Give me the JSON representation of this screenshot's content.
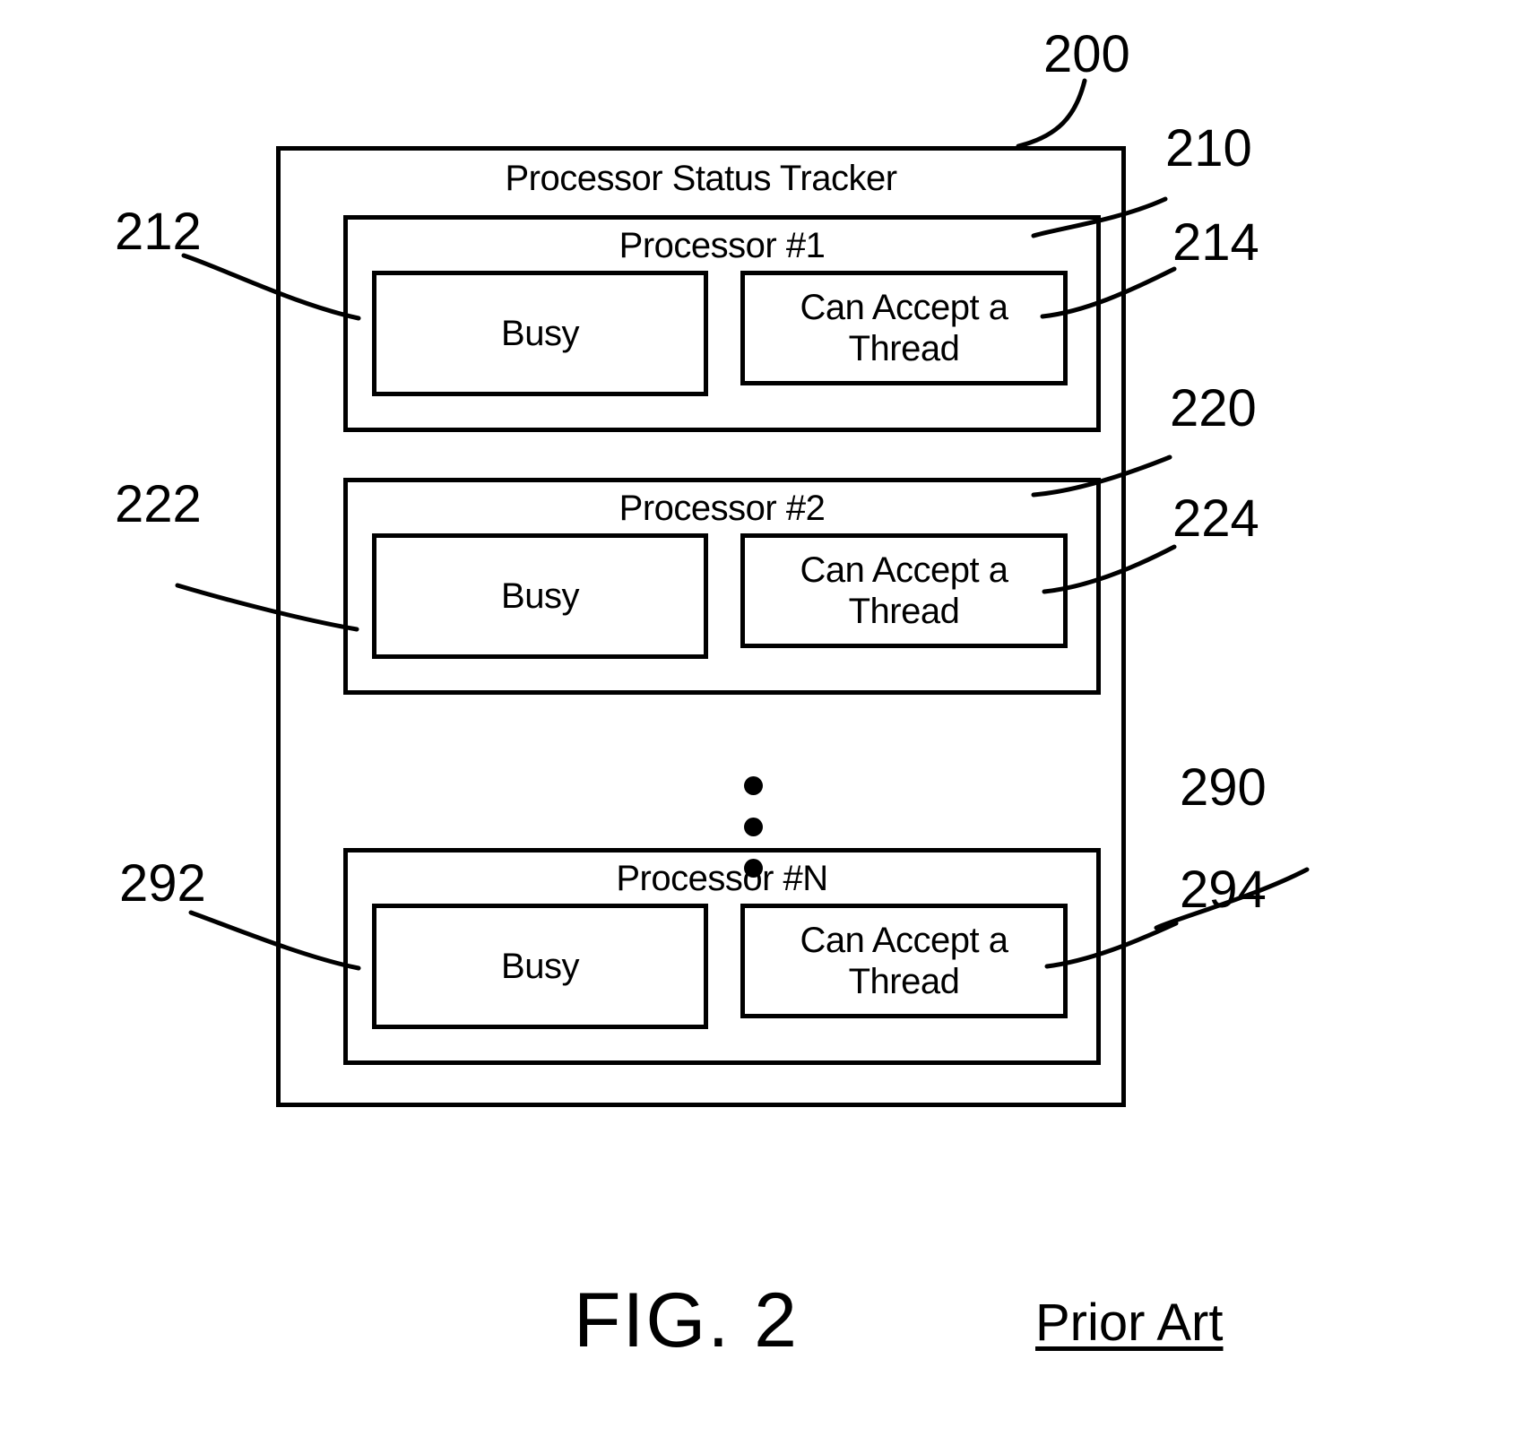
{
  "figure": {
    "caption": "FIG. 2",
    "status_note": "Prior Art",
    "root_ref": "200"
  },
  "tracker": {
    "title": "Processor Status Tracker",
    "ref": "200"
  },
  "processors": [
    {
      "title": "Processor #1",
      "ref": "210",
      "busy_label": "Busy",
      "busy_ref": "212",
      "accept_label": "Can Accept a Thread",
      "accept_ref": "214"
    },
    {
      "title": "Processor #2",
      "ref": "220",
      "busy_label": "Busy",
      "busy_ref": "222",
      "accept_label": "Can Accept a Thread",
      "accept_ref": "224"
    },
    {
      "title": "Processor #N",
      "ref": "290",
      "busy_label": "Busy",
      "busy_ref": "292",
      "accept_label": "Can Accept a Thread",
      "accept_ref": "294"
    }
  ],
  "ellipsis": {
    "symbol": "vertical-ellipsis",
    "dot_count": 3
  },
  "colors": {
    "ink": "#000000",
    "paper": "#ffffff"
  }
}
